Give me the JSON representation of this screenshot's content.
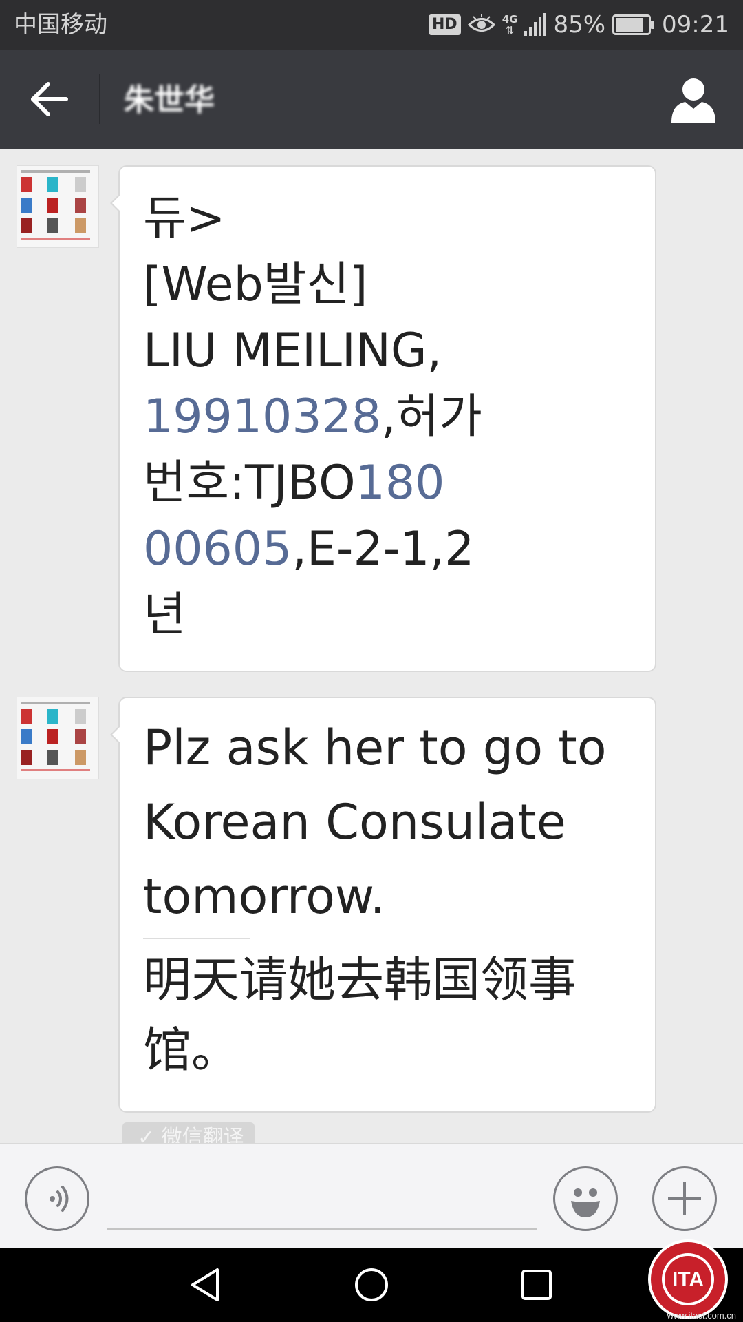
{
  "status_bar": {
    "carrier": "中国移动",
    "hd_badge": "HD",
    "network": "4G",
    "battery_percent": "85%",
    "battery_level": 0.85,
    "time": "09:21"
  },
  "header": {
    "title": "朱世华",
    "back_icon": "arrow-left-icon",
    "profile_icon": "person-icon"
  },
  "messages": [
    {
      "sender": "contact",
      "lines": [
        [
          {
            "text": "듀>"
          }
        ],
        [
          {
            "text": "[Web발신]"
          }
        ],
        [
          {
            "text": "LIU MEILING,"
          }
        ],
        [
          {
            "text": "19910328",
            "link": true
          },
          {
            "text": ",허가"
          }
        ],
        [
          {
            "text": "번호:TJBO"
          },
          {
            "text": "180",
            "link": true
          }
        ],
        [
          {
            "text": "00605",
            "link": true
          },
          {
            "text": ",E-2-1,2"
          }
        ],
        [
          {
            "text": "년"
          }
        ]
      ]
    },
    {
      "sender": "contact",
      "english_lines": [
        "Plz ask her to go to",
        "Korean Consulate",
        "tomorrow."
      ],
      "translation_lines": [
        "明天请她去韩国领事",
        "馆。"
      ],
      "translation_tag": "✓ 微信翻译"
    }
  ],
  "input_bar": {
    "placeholder": "",
    "voice_icon": "voice-icon",
    "emoji_icon": "emoji-icon",
    "plus_icon": "plus-icon"
  },
  "nav_bar": {
    "back_icon": "triangle-back-icon",
    "home_icon": "circle-home-icon",
    "recent_icon": "square-recent-icon"
  },
  "watermark": {
    "label": "ITA",
    "url": "www.itact.com.cn"
  },
  "colors": {
    "status_bar": "#2e2e30",
    "title_bar": "#393a3f",
    "chat_background": "#ebebeb",
    "bubble": "#ffffff",
    "link": "#576b95",
    "nav_bar": "#000000",
    "watermark_red": "#c8202a"
  }
}
